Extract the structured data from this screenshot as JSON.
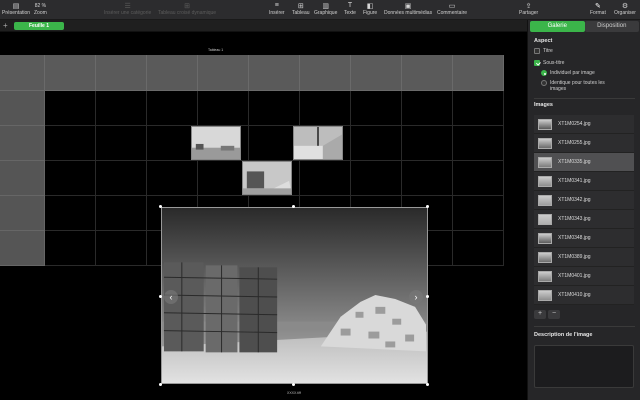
{
  "toolbar": {
    "presentation_label": "Présentation",
    "zoom_value": "82 %",
    "zoom_label": "Zoom",
    "add_category_label": "Insérer une catégorie",
    "pivot_label": "Tableau croisé dynamique",
    "insert_label": "Insérer",
    "table_label": "Tableau",
    "chart_label": "Graphique",
    "text_label": "Texte",
    "shape_label": "Figure",
    "media_label": "Données multimédias",
    "comment_label": "Commentaire",
    "share_label": "Partager",
    "format_label": "Format",
    "organize_label": "Organiser"
  },
  "sheets": {
    "add": "+",
    "active": "Feuille 1"
  },
  "canvas": {
    "table_title": "Tableau 1",
    "photo_caption": "XXXX.tiff"
  },
  "inspector": {
    "tabs": {
      "gallery": "Galerie",
      "layout": "Disposition"
    },
    "aspect_title": "Aspect",
    "title_option": "Titre",
    "subtitle_option": "Sous-titre",
    "per_image": "Individuel par image",
    "same_for_all": "Identique pour toutes les images",
    "images_title": "Images",
    "images": [
      "XT1M0254.jpg",
      "XT1M0255.jpg",
      "XT1M0335.jpg",
      "XT1M0341.jpg",
      "XT1M0342.jpg",
      "XT1M0343.jpg",
      "XT1M0348.jpg",
      "XT1M0389.jpg",
      "XT1M0401.jpg",
      "XT1M0410.jpg"
    ],
    "selected_index": 2,
    "add_button": "+",
    "remove_button": "−",
    "description_title": "Description de l'image"
  },
  "colors": {
    "accent": "#3bb54a"
  }
}
